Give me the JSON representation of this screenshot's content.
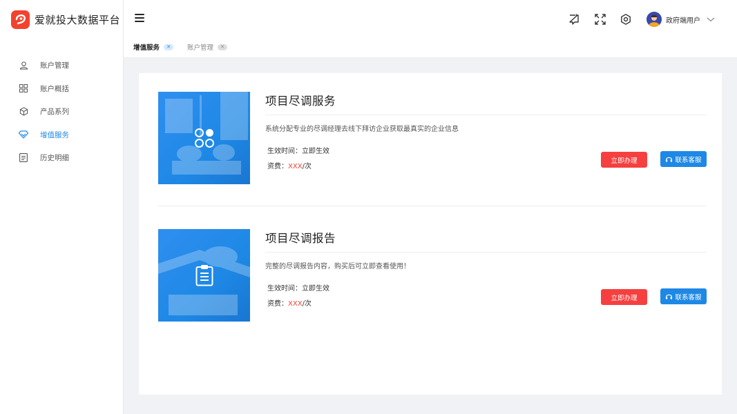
{
  "brand": {
    "title": "爱就投大数据平台",
    "logo_color": "#f2432f"
  },
  "sidebar": {
    "items": [
      {
        "label": "账户管理",
        "icon": "user-icon",
        "active": false
      },
      {
        "label": "账户概括",
        "icon": "grid-icon",
        "active": false
      },
      {
        "label": "产品系列",
        "icon": "cube-icon",
        "active": false
      },
      {
        "label": "增值服务",
        "icon": "diamond-icon",
        "active": true
      },
      {
        "label": "历史明细",
        "icon": "list-icon",
        "active": false
      }
    ]
  },
  "header": {
    "user_name": "政府端用户",
    "icons": [
      "message-icon",
      "fullscreen-icon",
      "settings-icon"
    ]
  },
  "tabs": [
    {
      "label": "增值服务",
      "active": true
    },
    {
      "label": "账户管理",
      "active": false
    }
  ],
  "cards": [
    {
      "title": "项目尽调服务",
      "desc": "系统分配专业的尽调经理去线下拜访企业获取最真实的企业信息",
      "effective_label": "生效时间：立即生效",
      "price_label": "资费：",
      "price_value": "XXX",
      "price_unit": "/次",
      "action_label": "立即办理",
      "contact_label": "联系客服"
    },
    {
      "title": "项目尽调报告",
      "desc": "完整的尽调报告内容，购买后可立即查看使用！",
      "effective_label": "生效时间：立即生效",
      "price_label": "资费：",
      "price_value": "XXX",
      "price_unit": "/次",
      "action_label": "立即办理",
      "contact_label": "联系客服"
    }
  ],
  "colors": {
    "accent": "#1e88e5",
    "danger": "#f5403f"
  }
}
